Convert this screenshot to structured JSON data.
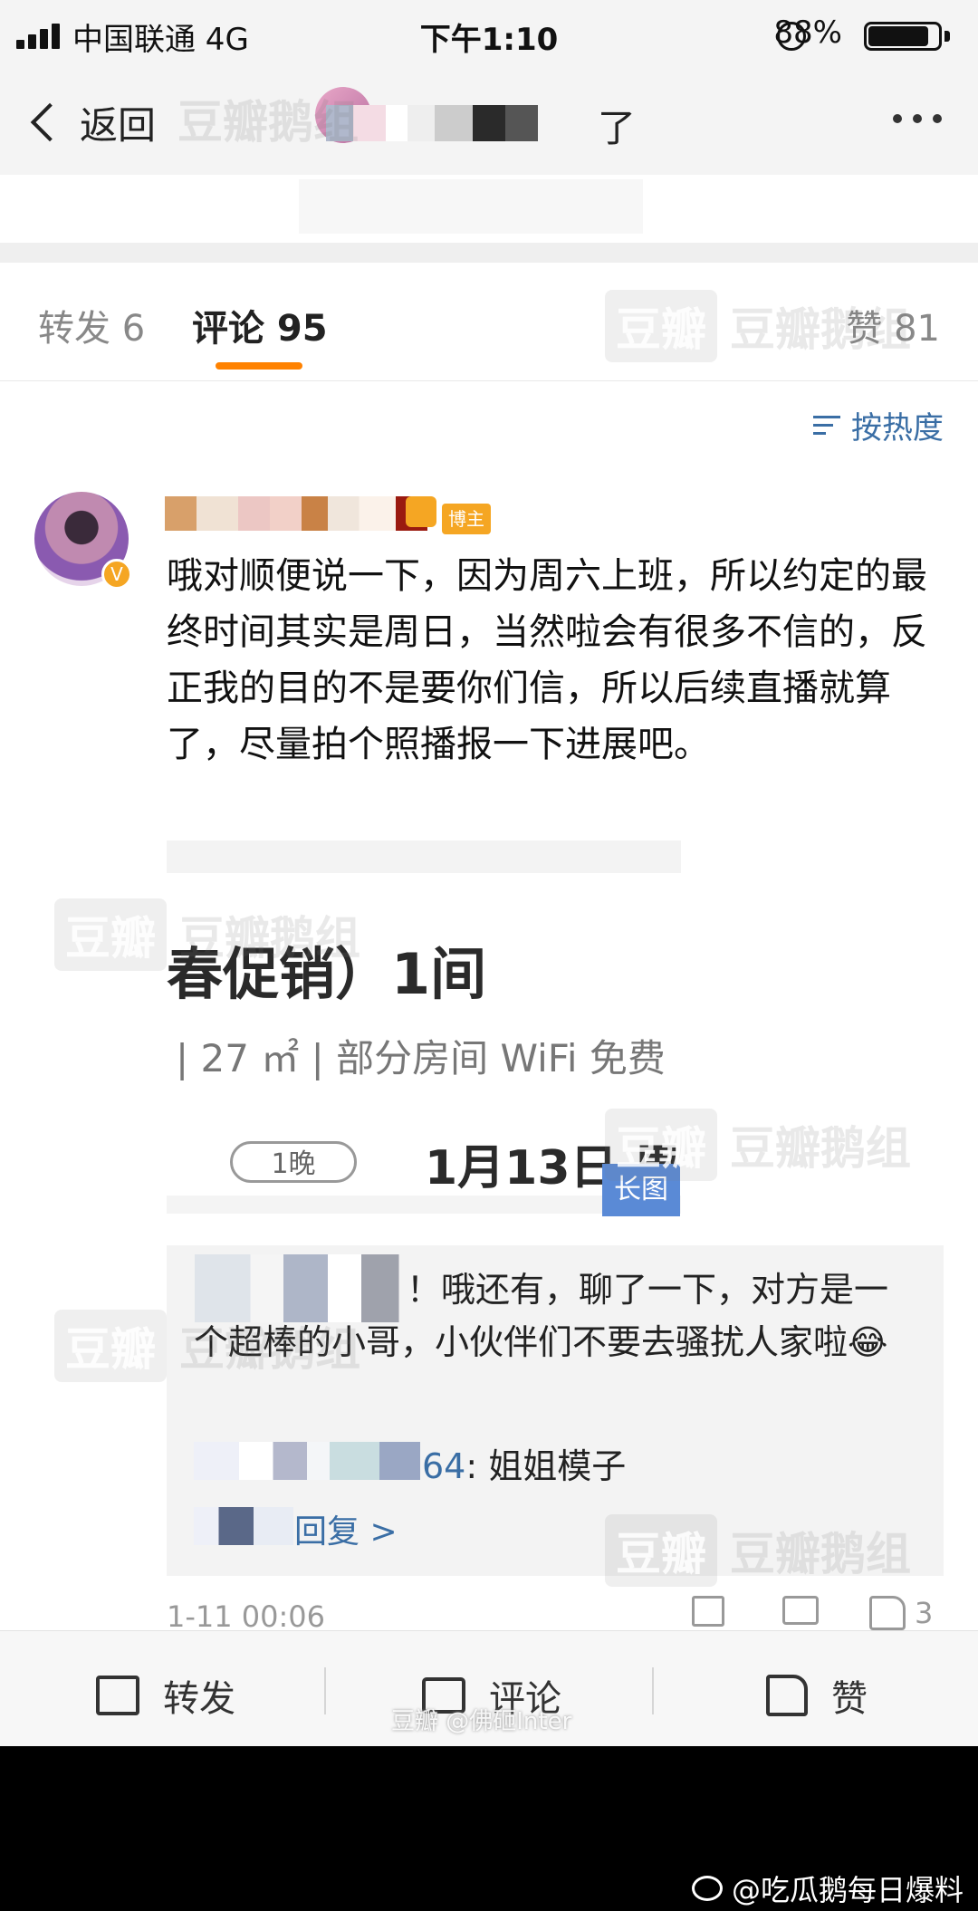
{
  "status_bar": {
    "carrier": "中国联通 4G",
    "time": "下午1:10",
    "battery": "88%"
  },
  "nav": {
    "back_label": "返回",
    "title_tail": "了"
  },
  "tabs": [
    {
      "label": "转发 6"
    },
    {
      "label": "评论 95"
    },
    {
      "label": "赞 81"
    }
  ],
  "sort_label": "按热度",
  "comment": {
    "badge": "博主",
    "text": "哦对顺便说一下，因为周六上班，所以约定的最终时间其实是周日，当然啦会有很多不信的，反正我的目的不是要你们信，所以后续直播就算了，尽量拍个照播报一下进展吧。",
    "image": {
      "line1": "春促销）1间",
      "line2": "| 27 ㎡ | 部分房间 WiFi 免费",
      "nights": "1晚",
      "date": "1月13日 周",
      "long_badge": "长图"
    },
    "reply1": "！哦还有，聊了一下，对方是一个超棒的小哥，小伙伴们不要去骚扰人家啦😂",
    "reply2_prefix": "64",
    "reply2_text": ": 姐姐模子",
    "reply_more": "回复 >",
    "time": "1-11 00:06",
    "likes": "3"
  },
  "bottom_bar": {
    "share": "转发",
    "comment": "评论",
    "like": "赞"
  },
  "watermarks": {
    "group": "豆瓣鹅组",
    "logo": "豆瓣",
    "douban_mark": "豆瓣 @佛砸Inter",
    "footer": "@吃瓜鹅每日爆料"
  }
}
